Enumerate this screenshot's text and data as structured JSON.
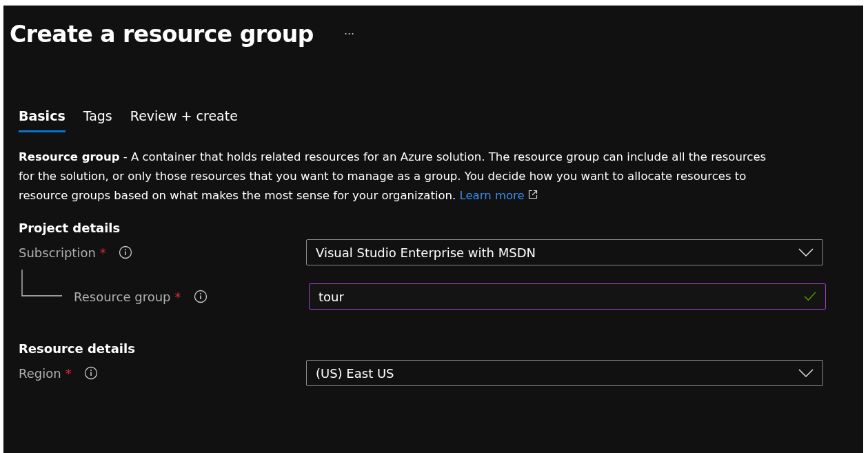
{
  "page": {
    "title": "Create a resource group",
    "more": "···"
  },
  "tabs": [
    {
      "label": "Basics",
      "selected": true
    },
    {
      "label": "Tags",
      "selected": false
    },
    {
      "label": "Review + create",
      "selected": false
    }
  ],
  "description": {
    "text": "**Resource group** - A container that holds related resources for an Azure solution. The resource group can include all the resources for the solution, or only those resources that you want to manage as a group. You decide how you want to allocate resources to resource groups based on what makes the most sense for your organization.",
    "link": "Learn more"
  },
  "sections": [
    {
      "heading": "Project details",
      "fields": [
        {
          "kind": "dropdown",
          "label": "Subscription",
          "required_mark": "*",
          "value": "Visual Studio Enterprise with MSDN",
          "focused": false,
          "children": [
            {
              "kind": "text",
              "label": "Resource group",
              "required_mark": "*",
              "value": "tour",
              "valid": true,
              "focused": true
            }
          ]
        }
      ]
    },
    {
      "heading": "Resource details",
      "fields": [
        {
          "kind": "dropdown",
          "label": "Region",
          "required_mark": "*",
          "value": "(US) East US",
          "focused": false
        }
      ]
    }
  ]
}
